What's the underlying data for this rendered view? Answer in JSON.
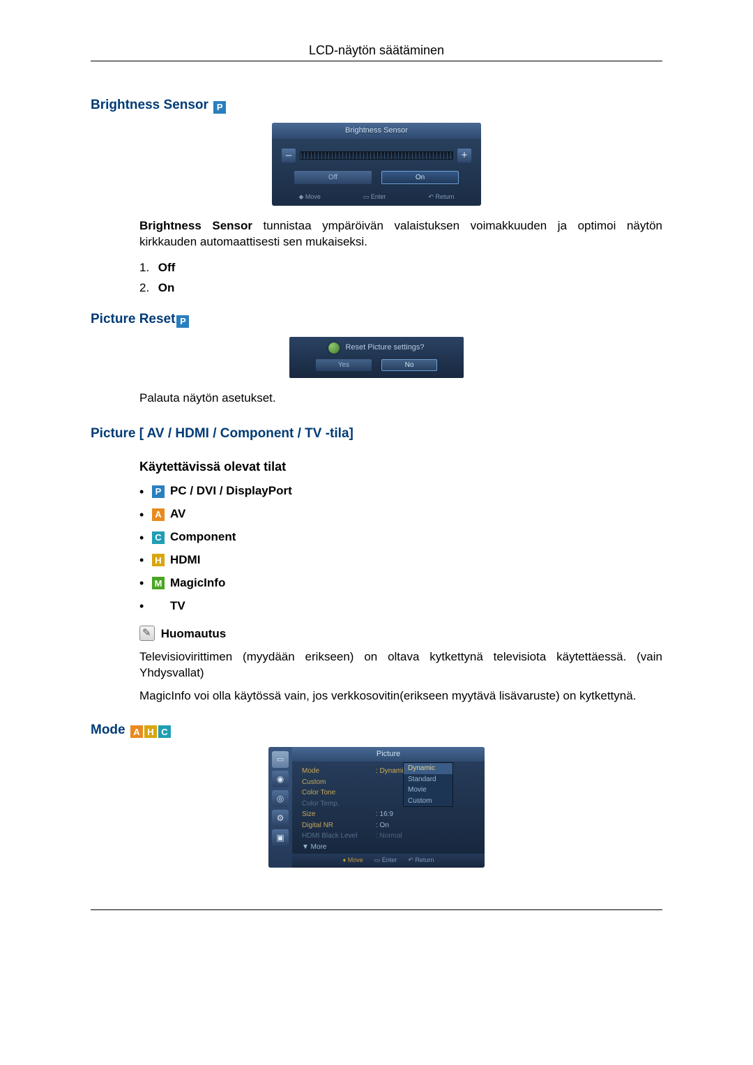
{
  "header": {
    "title": "LCD-näytön säätäminen"
  },
  "brightnessSensor": {
    "heading": "Brightness Sensor",
    "osd": {
      "title": "Brightness Sensor",
      "minus": "–",
      "plus": "+",
      "off": "Off",
      "on": "On",
      "footMove": "Move",
      "footEnter": "Enter",
      "footReturn": "Return"
    },
    "desc_lead": "Brightness Sensor",
    "desc_rest": " tunnistaa ympäröivän valaistuksen voimakkuuden ja optimoi näytön kirkkauden automaattisesti sen mukaiseksi.",
    "opt1_num": "1.",
    "opt1_label": "Off",
    "opt2_num": "2.",
    "opt2_label": "On"
  },
  "pictureReset": {
    "heading": "Picture Reset",
    "osd": {
      "question": "Reset Picture settings?",
      "yes": "Yes",
      "no": "No"
    },
    "desc": "Palauta näytön asetukset."
  },
  "pictureMode": {
    "heading": "Picture [ AV / HDMI / Component / TV -tila]",
    "subheading": "Käytettävissä olevat tilat",
    "modes": {
      "p": {
        "letter": "P",
        "label": "PC / DVI / DisplayPort"
      },
      "a": {
        "letter": "A",
        "label": "AV"
      },
      "c": {
        "letter": "C",
        "label": "Component"
      },
      "h": {
        "letter": "H",
        "label": "HDMI"
      },
      "m": {
        "letter": "M",
        "label": "MagicInfo"
      },
      "tv": {
        "label": "TV"
      }
    },
    "note_label": "Huomautus",
    "note_p1": "Televisiovirittimen (myydään erikseen) on oltava kytkettynä televisiota käytettäessä. (vain Yhdysvallat)",
    "note_p2": "MagicInfo voi olla käytössä vain, jos verkkosovitin(erikseen myytävä lisävaruste) on kytkettynä."
  },
  "modeSection": {
    "heading": "Mode",
    "icons": {
      "a": "A",
      "h": "H",
      "c": "C"
    },
    "osd": {
      "title": "Picture",
      "rows": {
        "mode_k": "Mode",
        "mode_v": "Dynamic",
        "custom_k": "Custom",
        "colortone_k": "Color Tone",
        "colortemp_k": "Color Temp.",
        "size_k": "Size",
        "size_v": ": 16:9",
        "dnr_k": "Digital NR",
        "dnr_v": ": On",
        "hdmibl_k": "HDMI Black Level",
        "hdmibl_v": ": Normal",
        "more_k": "▼ More"
      },
      "popup": {
        "dynamic": "Dynamic",
        "standard": "Standard",
        "movie": "Movie",
        "custom": "Custom"
      },
      "footMove": "Move",
      "footEnter": "Enter",
      "footReturn": "Return"
    }
  }
}
